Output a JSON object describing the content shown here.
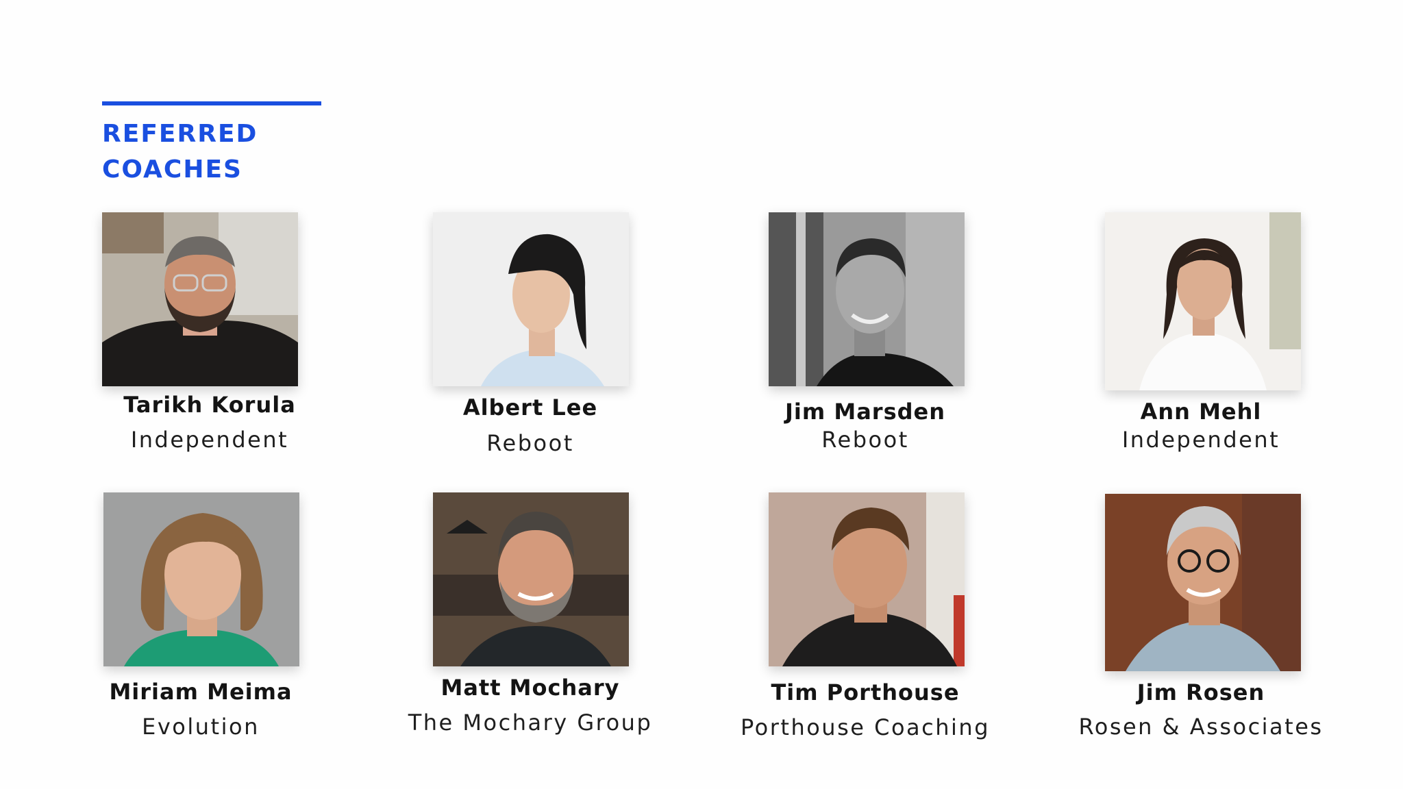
{
  "header": {
    "line1": "REFERRED",
    "line2": "COACHES",
    "accent_color": "#1a4fe0"
  },
  "coaches": [
    {
      "name": "Tarikh Korula",
      "org": "Independent",
      "photo_icon": "portrait-photo"
    },
    {
      "name": "Albert Lee",
      "org": "Reboot",
      "photo_icon": "portrait-photo"
    },
    {
      "name": "Jim Marsden",
      "org": "Reboot",
      "photo_icon": "portrait-photo"
    },
    {
      "name": "Ann Mehl",
      "org": "Independent",
      "photo_icon": "portrait-photo"
    },
    {
      "name": "Miriam Meima",
      "org": "Evolution",
      "photo_icon": "portrait-photo"
    },
    {
      "name": "Matt Mochary",
      "org": "The Mochary Group",
      "photo_icon": "portrait-photo"
    },
    {
      "name": "Tim Porthouse",
      "org": "Porthouse Coaching",
      "photo_icon": "portrait-photo"
    },
    {
      "name": "Jim Rosen",
      "org": "Rosen & Associates",
      "photo_icon": "portrait-photo"
    }
  ]
}
